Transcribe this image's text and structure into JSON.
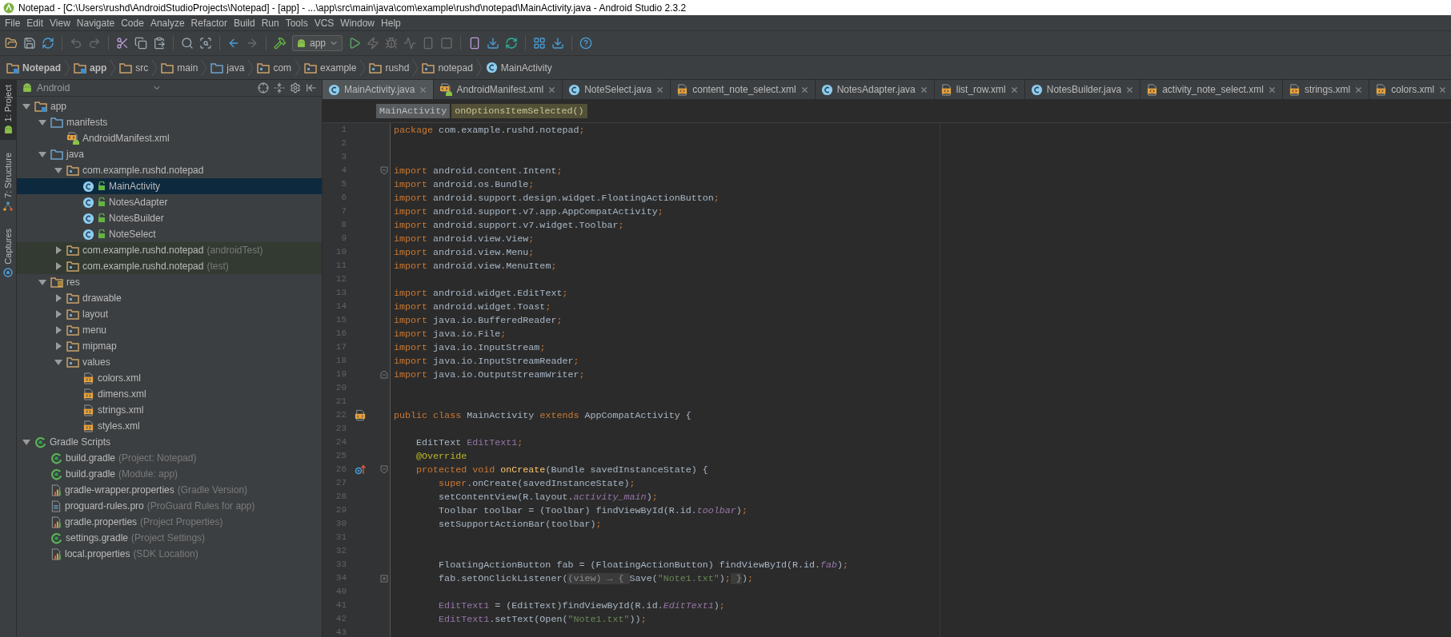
{
  "window": {
    "title": "Notepad - [C:\\Users\\rushd\\AndroidStudioProjects\\Notepad] - [app] - ...\\app\\src\\main\\java\\com\\example\\rushd\\notepad\\MainActivity.java - Android Studio 2.3.2"
  },
  "menu": [
    "File",
    "Edit",
    "View",
    "Navigate",
    "Code",
    "Analyze",
    "Refactor",
    "Build",
    "Run",
    "Tools",
    "VCS",
    "Window",
    "Help"
  ],
  "toolbar": {
    "run_config": "app"
  },
  "nav_bar": [
    {
      "label": "Notepad",
      "kind": "project"
    },
    {
      "label": "app",
      "kind": "module"
    },
    {
      "label": "src",
      "kind": "folder"
    },
    {
      "label": "main",
      "kind": "folder"
    },
    {
      "label": "java",
      "kind": "source_folder"
    },
    {
      "label": "com",
      "kind": "package"
    },
    {
      "label": "example",
      "kind": "package"
    },
    {
      "label": "rushd",
      "kind": "package"
    },
    {
      "label": "notepad",
      "kind": "package"
    },
    {
      "label": "MainActivity",
      "kind": "class"
    }
  ],
  "tool_strip": [
    {
      "label": "1: Project",
      "kind": "project",
      "selected": true
    },
    {
      "label": "7: Structure",
      "kind": "structure",
      "selected": false
    },
    {
      "label": "Captures",
      "kind": "captures",
      "selected": false
    }
  ],
  "project_panel": {
    "view": "Android",
    "tree": [
      {
        "label": "app",
        "kind": "module",
        "expanded": true,
        "selected": false,
        "children": [
          {
            "label": "manifests",
            "kind": "source_folder",
            "expanded": true,
            "selected": false,
            "children": [
              {
                "label": "AndroidManifest.xml",
                "kind": "manifest",
                "selected": false
              }
            ]
          },
          {
            "label": "java",
            "kind": "source_folder",
            "expanded": true,
            "selected": false,
            "children": [
              {
                "label": "com.example.rushd.notepad",
                "kind": "package",
                "expanded": true,
                "selected": false,
                "children": [
                  {
                    "label": "MainActivity",
                    "kind": "class",
                    "selected": true
                  },
                  {
                    "label": "NotesAdapter",
                    "kind": "class",
                    "selected": false
                  },
                  {
                    "label": "NotesBuilder",
                    "kind": "class",
                    "selected": false
                  },
                  {
                    "label": "NoteSelect",
                    "kind": "class",
                    "selected": false
                  }
                ]
              },
              {
                "label": "com.example.rushd.notepad",
                "note": "(androidTest)",
                "kind": "test_package",
                "expanded": false,
                "selected": false
              },
              {
                "label": "com.example.rushd.notepad",
                "note": "(test)",
                "kind": "test_package",
                "expanded": false,
                "selected": false
              }
            ]
          },
          {
            "label": "res",
            "kind": "res_folder",
            "expanded": true,
            "selected": false,
            "children": [
              {
                "label": "drawable",
                "kind": "package",
                "expanded": false,
                "selected": false
              },
              {
                "label": "layout",
                "kind": "package",
                "expanded": false,
                "selected": false
              },
              {
                "label": "menu",
                "kind": "package",
                "expanded": false,
                "selected": false
              },
              {
                "label": "mipmap",
                "kind": "package",
                "expanded": false,
                "selected": false
              },
              {
                "label": "values",
                "kind": "package",
                "expanded": true,
                "selected": false,
                "children": [
                  {
                    "label": "colors.xml",
                    "kind": "xml",
                    "selected": false
                  },
                  {
                    "label": "dimens.xml",
                    "kind": "xml",
                    "selected": false
                  },
                  {
                    "label": "strings.xml",
                    "kind": "xml",
                    "selected": false
                  },
                  {
                    "label": "styles.xml",
                    "kind": "xml",
                    "selected": false
                  }
                ]
              }
            ]
          }
        ]
      },
      {
        "label": "Gradle Scripts",
        "kind": "gradle",
        "expanded": true,
        "selected": false,
        "children": [
          {
            "label": "build.gradle",
            "note": "(Project: Notepad)",
            "kind": "gradle",
            "selected": false
          },
          {
            "label": "build.gradle",
            "note": "(Module: app)",
            "kind": "gradle",
            "selected": false
          },
          {
            "label": "gradle-wrapper.properties",
            "note": "(Gradle Version)",
            "kind": "properties",
            "selected": false
          },
          {
            "label": "proguard-rules.pro",
            "note": "(ProGuard Rules for app)",
            "kind": "text",
            "selected": false
          },
          {
            "label": "gradle.properties",
            "note": "(Project Properties)",
            "kind": "properties",
            "selected": false
          },
          {
            "label": "settings.gradle",
            "note": "(Project Settings)",
            "kind": "gradle",
            "selected": false
          },
          {
            "label": "local.properties",
            "note": "(SDK Location)",
            "kind": "properties",
            "selected": false
          }
        ]
      }
    ]
  },
  "editor_tabs": [
    {
      "label": "MainActivity.java",
      "kind": "class",
      "selected": true
    },
    {
      "label": "AndroidManifest.xml",
      "kind": "manifest",
      "selected": false
    },
    {
      "label": "NoteSelect.java",
      "kind": "class",
      "selected": false
    },
    {
      "label": "content_note_select.xml",
      "kind": "xml",
      "selected": false
    },
    {
      "label": "NotesAdapter.java",
      "kind": "class",
      "selected": false
    },
    {
      "label": "list_row.xml",
      "kind": "xml",
      "selected": false
    },
    {
      "label": "NotesBuilder.java",
      "kind": "class",
      "selected": false
    },
    {
      "label": "activity_note_select.xml",
      "kind": "xml",
      "selected": false
    },
    {
      "label": "strings.xml",
      "kind": "xml",
      "selected": false
    },
    {
      "label": "colors.xml",
      "kind": "xml",
      "selected": false
    }
  ],
  "editor_breadcrumbs": [
    {
      "label": "MainActivity",
      "kind": "class"
    },
    {
      "label": "onOptionsItemSelected()",
      "kind": "method"
    }
  ],
  "code_lines": [
    {
      "number": "1",
      "tokens": [
        {
          "text": "package",
          "kind": "keyword"
        },
        {
          "text": " com.example.rushd.notepad",
          "kind": "plain"
        },
        {
          "text": ";",
          "kind": "keyword"
        }
      ]
    },
    {
      "number": "2"
    },
    {
      "number": "3"
    },
    {
      "number": "4",
      "fold": {
        "kind": "open"
      },
      "tokens": [
        {
          "text": "import",
          "kind": "keyword"
        },
        {
          "text": " android.content.Intent",
          "kind": "plain"
        },
        {
          "text": ";",
          "kind": "keyword"
        }
      ]
    },
    {
      "number": "5",
      "tokens": [
        {
          "text": "import",
          "kind": "keyword"
        },
        {
          "text": " android.os.Bundle",
          "kind": "plain"
        },
        {
          "text": ";",
          "kind": "keyword"
        }
      ]
    },
    {
      "number": "6",
      "tokens": [
        {
          "text": "import",
          "kind": "keyword"
        },
        {
          "text": " android.support.design.widget.FloatingActionButton",
          "kind": "plain"
        },
        {
          "text": ";",
          "kind": "keyword"
        }
      ]
    },
    {
      "number": "7",
      "tokens": [
        {
          "text": "import",
          "kind": "keyword"
        },
        {
          "text": " android.support.v7.app.AppCompatActivity",
          "kind": "plain"
        },
        {
          "text": ";",
          "kind": "keyword"
        }
      ]
    },
    {
      "number": "8",
      "tokens": [
        {
          "text": "import",
          "kind": "keyword"
        },
        {
          "text": " android.support.v7.widget.Toolbar",
          "kind": "plain"
        },
        {
          "text": ";",
          "kind": "keyword"
        }
      ]
    },
    {
      "number": "9",
      "tokens": [
        {
          "text": "import",
          "kind": "keyword"
        },
        {
          "text": " android.view.View",
          "kind": "plain"
        },
        {
          "text": ";",
          "kind": "keyword"
        }
      ]
    },
    {
      "number": "10",
      "tokens": [
        {
          "text": "import",
          "kind": "keyword"
        },
        {
          "text": " android.view.Menu",
          "kind": "plain"
        },
        {
          "text": ";",
          "kind": "keyword"
        }
      ]
    },
    {
      "number": "11",
      "tokens": [
        {
          "text": "import",
          "kind": "keyword"
        },
        {
          "text": " android.view.MenuItem",
          "kind": "plain"
        },
        {
          "text": ";",
          "kind": "keyword"
        }
      ]
    },
    {
      "number": "12"
    },
    {
      "number": "13",
      "tokens": [
        {
          "text": "import",
          "kind": "keyword"
        },
        {
          "text": " android.widget.EditText",
          "kind": "plain"
        },
        {
          "text": ";",
          "kind": "keyword"
        }
      ]
    },
    {
      "number": "14",
      "tokens": [
        {
          "text": "import",
          "kind": "keyword"
        },
        {
          "text": " android.widget.Toast",
          "kind": "plain"
        },
        {
          "text": ";",
          "kind": "keyword"
        }
      ]
    },
    {
      "number": "15",
      "tokens": [
        {
          "text": "import",
          "kind": "keyword"
        },
        {
          "text": " java.io.BufferedReader",
          "kind": "plain"
        },
        {
          "text": ";",
          "kind": "keyword"
        }
      ]
    },
    {
      "number": "16",
      "tokens": [
        {
          "text": "import",
          "kind": "keyword"
        },
        {
          "text": " java.io.File",
          "kind": "plain"
        },
        {
          "text": ";",
          "kind": "keyword"
        }
      ]
    },
    {
      "number": "17",
      "tokens": [
        {
          "text": "import",
          "kind": "keyword"
        },
        {
          "text": " java.io.InputStream",
          "kind": "plain"
        },
        {
          "text": ";",
          "kind": "keyword"
        }
      ]
    },
    {
      "number": "18",
      "tokens": [
        {
          "text": "import",
          "kind": "keyword"
        },
        {
          "text": " java.io.InputStreamReader",
          "kind": "plain"
        },
        {
          "text": ";",
          "kind": "keyword"
        }
      ]
    },
    {
      "number": "19",
      "fold": {
        "kind": "close"
      },
      "tokens": [
        {
          "text": "import",
          "kind": "keyword"
        },
        {
          "text": " java.io.OutputStreamWriter",
          "kind": "plain"
        },
        {
          "text": ";",
          "kind": "keyword"
        }
      ]
    },
    {
      "number": "20"
    },
    {
      "number": "21"
    },
    {
      "number": "22",
      "gutter": {
        "kind": "layout"
      },
      "tokens": [
        {
          "text": "public class ",
          "kind": "keyword"
        },
        {
          "text": "MainActivity ",
          "kind": "plain"
        },
        {
          "text": "extends ",
          "kind": "keyword"
        },
        {
          "text": "AppCompatActivity {",
          "kind": "plain"
        }
      ]
    },
    {
      "number": "23"
    },
    {
      "number": "24",
      "tokens": [
        {
          "text": "    EditText ",
          "kind": "plain"
        },
        {
          "text": "EditText1",
          "kind": "field"
        },
        {
          "text": ";",
          "kind": "keyword"
        }
      ]
    },
    {
      "number": "25",
      "tokens": [
        {
          "text": "    @Override",
          "kind": "annotation"
        }
      ]
    },
    {
      "number": "26",
      "gutter": {
        "kind": "override"
      },
      "fold": {
        "kind": "open"
      },
      "tokens": [
        {
          "text": "    protected void ",
          "kind": "keyword"
        },
        {
          "text": "onCreate",
          "kind": "method"
        },
        {
          "text": "(Bundle savedInstanceState) {",
          "kind": "plain"
        }
      ]
    },
    {
      "number": "27",
      "tokens": [
        {
          "text": "        super",
          "kind": "keyword"
        },
        {
          "text": ".onCreate(savedInstanceState)",
          "kind": "plain"
        },
        {
          "text": ";",
          "kind": "keyword"
        }
      ]
    },
    {
      "number": "28",
      "tokens": [
        {
          "text": "        setContentView(R.layout.",
          "kind": "plain"
        },
        {
          "text": "activity_main",
          "kind": "static"
        },
        {
          "text": ")",
          "kind": "plain"
        },
        {
          "text": ";",
          "kind": "keyword"
        }
      ]
    },
    {
      "number": "29",
      "tokens": [
        {
          "text": "        Toolbar toolbar = (Toolbar) findViewById(R.id.",
          "kind": "plain"
        },
        {
          "text": "toolbar",
          "kind": "static"
        },
        {
          "text": ")",
          "kind": "plain"
        },
        {
          "text": ";",
          "kind": "keyword"
        }
      ]
    },
    {
      "number": "30",
      "tokens": [
        {
          "text": "        setSupportActionBar(toolbar)",
          "kind": "plain"
        },
        {
          "text": ";",
          "kind": "keyword"
        }
      ]
    },
    {
      "number": "31"
    },
    {
      "number": "32"
    },
    {
      "number": "33",
      "tokens": [
        {
          "text": "        FloatingActionButton fab = (FloatingActionButton) findViewById(R.id.",
          "kind": "plain"
        },
        {
          "text": "fab",
          "kind": "static"
        },
        {
          "text": ")",
          "kind": "plain"
        },
        {
          "text": ";",
          "kind": "keyword"
        }
      ]
    },
    {
      "number": "34",
      "fold": {
        "kind": "collapsed"
      },
      "tokens": [
        {
          "text": "        fab.setOnClickListener(",
          "kind": "plain"
        },
        {
          "text": "(view) → { ",
          "kind": "folded"
        },
        {
          "text": "Save(",
          "kind": "plain"
        },
        {
          "text": "\"Note1.txt\"",
          "kind": "string"
        },
        {
          "text": ")",
          "kind": "plain"
        },
        {
          "text": ";",
          "kind": "keyword"
        },
        {
          "text": " }",
          "kind": "folded"
        },
        {
          "text": ")",
          "kind": "plain"
        },
        {
          "text": ";",
          "kind": "keyword"
        }
      ]
    },
    {
      "number": "40"
    },
    {
      "number": "41",
      "tokens": [
        {
          "text": "        EditText1",
          "kind": "field"
        },
        {
          "text": " = (EditText)findViewById(R.id.",
          "kind": "plain"
        },
        {
          "text": "EditText1",
          "kind": "static"
        },
        {
          "text": ")",
          "kind": "plain"
        },
        {
          "text": ";",
          "kind": "keyword"
        }
      ]
    },
    {
      "number": "42",
      "tokens": [
        {
          "text": "        EditText1",
          "kind": "field"
        },
        {
          "text": ".setText(Open(",
          "kind": "plain"
        },
        {
          "text": "\"Note1.txt\"",
          "kind": "string"
        },
        {
          "text": "))",
          "kind": "plain"
        },
        {
          "text": ";",
          "kind": "keyword"
        }
      ]
    },
    {
      "number": "43"
    }
  ]
}
